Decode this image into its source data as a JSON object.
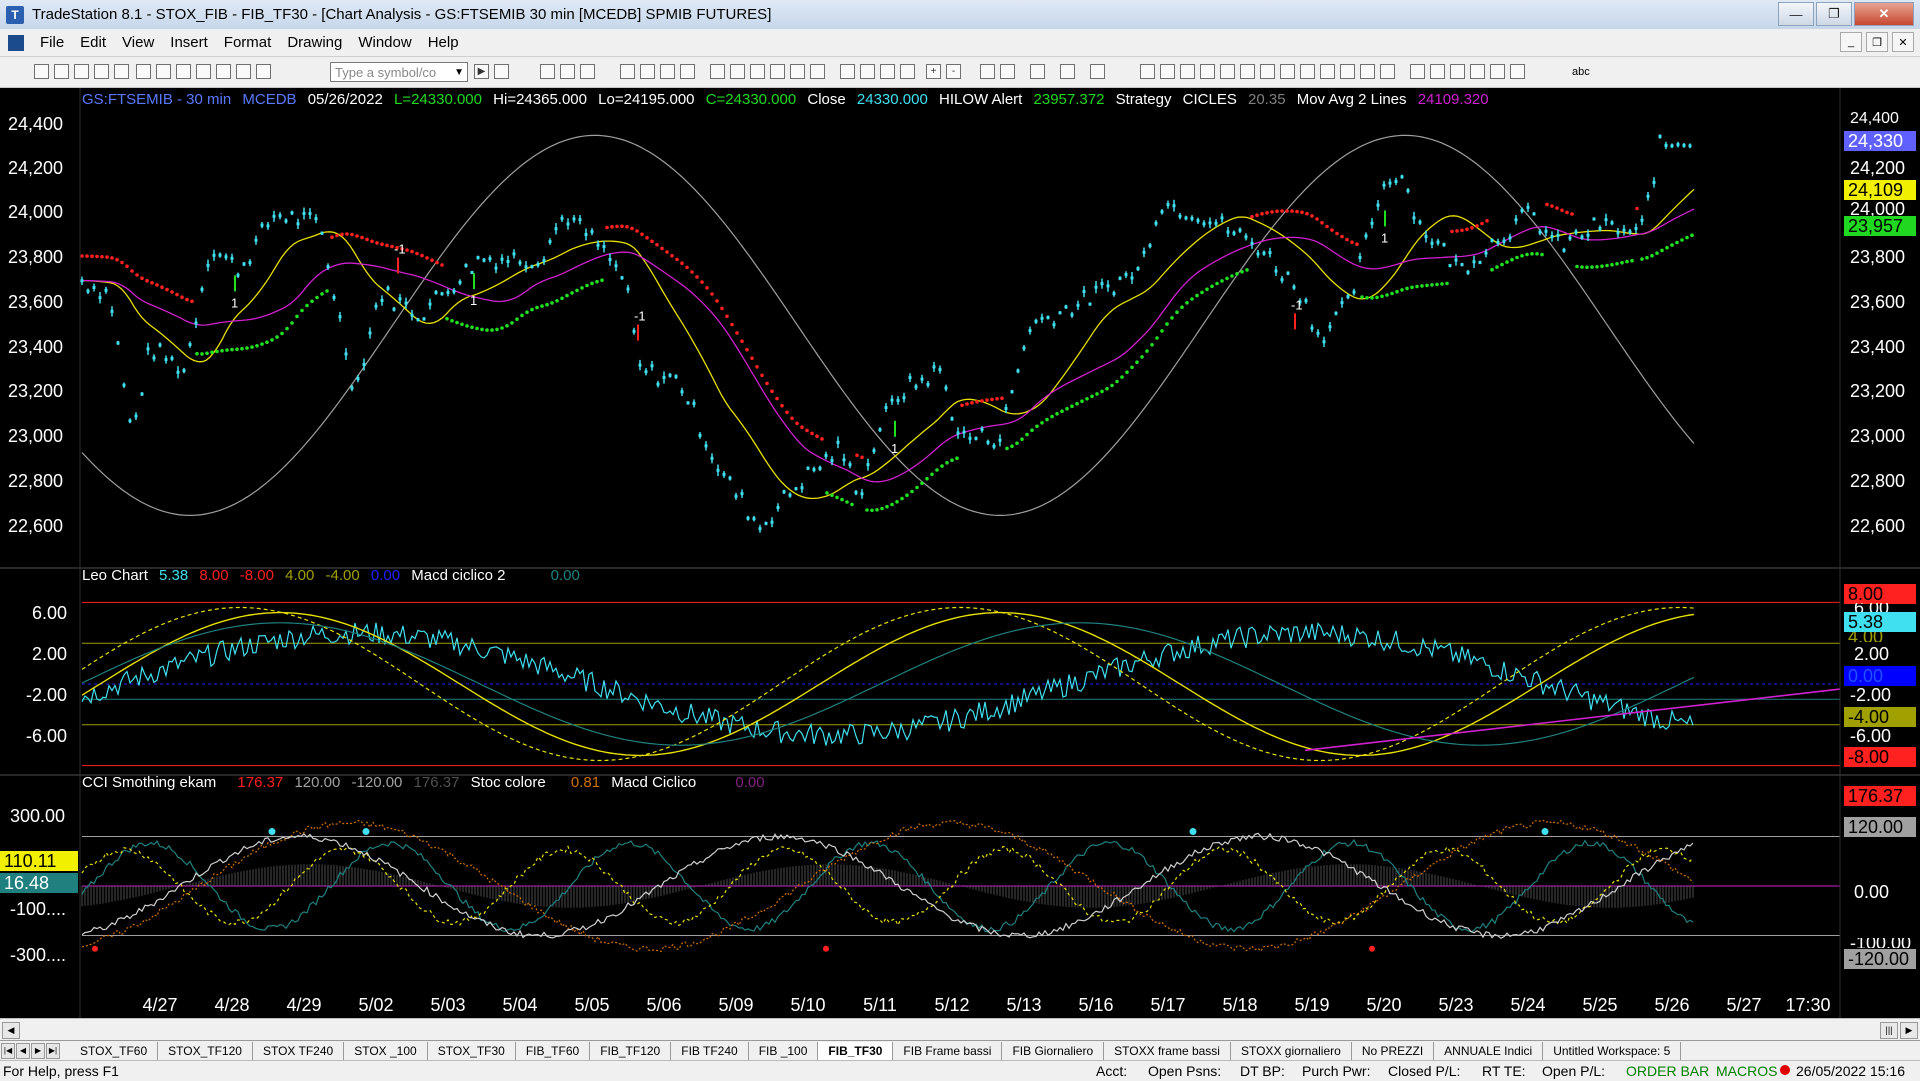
{
  "window": {
    "title": "TradeStation 8.1 - STOX_FIB - FIB_TF30 - [Chart Analysis - GS:FTSEMIB  30 min  [MCEDB] SPMIB FUTURES]",
    "icon": "tradestation-app-icon"
  },
  "menu": [
    "File",
    "Edit",
    "View",
    "Insert",
    "Format",
    "Drawing",
    "Window",
    "Help"
  ],
  "toolbar": {
    "symbol_placeholder": "Type a symbol/co",
    "text_tool": "abc"
  },
  "price_panel": {
    "header": {
      "symbol": "GS:FTSEMIB - 30 min",
      "feed": "MCEDB",
      "date": "05/26/2022",
      "low_label": "L=24330.000",
      "hi": "Hi=24365.000",
      "lo": "Lo=24195.000",
      "close_c": "C=24330.000",
      "close_label": "Close",
      "close_value": "24330.000",
      "hilow_label": "HILOW Alert",
      "hilow_value": "23957.372",
      "strategy_label": "Strategy",
      "cicles_label": "CICLES",
      "cicles_value": "20.35",
      "mavg_label": "Mov Avg 2 Lines",
      "mavg_value": "24109.320"
    },
    "y_labels": [
      "24,400",
      "24,200",
      "24,000",
      "23,800",
      "23,600",
      "23,400",
      "23,200",
      "23,000",
      "22,800",
      "22,600"
    ],
    "right_labels": {
      "top_partial": "24,400",
      "last": "24,330",
      "r200": "24,200",
      "mavg": "24,109",
      "r000": "24,000",
      "hilow": "23,957",
      "r800": "23,800",
      "r600": "23,600",
      "r400": "23,400",
      "r200b": "23,200",
      "r000b": "23,000",
      "r800b": "22,800",
      "r600b": "22,600"
    },
    "signal_labels": [
      "1",
      "-1",
      "1",
      "-1",
      "1",
      "1",
      "-1",
      "1"
    ]
  },
  "leo_panel": {
    "header": {
      "name": "Leo Chart",
      "v1": "5.38",
      "v2": "8.00",
      "v3": "-8.00",
      "v4": "4.00",
      "v5": "-4.00",
      "v6": "0.00",
      "macd_label": "Macd ciclico 2",
      "macd_value": "0.00"
    },
    "y_labels": [
      "6.00",
      "2.00",
      "-2.00",
      "-6.00"
    ],
    "right_labels": [
      "8.00",
      "6.00",
      "5.38",
      "4.00",
      "2.00",
      "0.00",
      "-2.00",
      "-4.00",
      "-6.00",
      "-8.00"
    ]
  },
  "cci_panel": {
    "header": {
      "name": "CCI Smothing ekam",
      "v1": "176.37",
      "v2": "120.00",
      "v3": "-120.00",
      "v4": "176.37",
      "stoc_label": "Stoc colore",
      "stoc_value": "0.81",
      "macd_label": "Macd Ciclico",
      "macd_value": "0.00"
    },
    "y_labels": [
      "300.00",
      "-100....",
      "-300...."
    ],
    "left_boxes": [
      "110.11",
      "16.48"
    ],
    "right_labels": [
      "176.37",
      "120.00",
      "0.00",
      "-100.00",
      "-120.00"
    ]
  },
  "x_axis": [
    "4/27",
    "4/28",
    "4/29",
    "5/02",
    "5/03",
    "5/04",
    "5/05",
    "5/06",
    "5/09",
    "5/10",
    "5/11",
    "5/12",
    "5/13",
    "5/16",
    "5/17",
    "5/18",
    "5/19",
    "5/20",
    "5/23",
    "5/24",
    "5/25",
    "5/26",
    "5/27",
    "17:30"
  ],
  "tabs": [
    "STOX_TF60",
    "STOX_TF120",
    "STOX TF240",
    "STOX _100",
    "STOX_TF30",
    "FIB_TF60",
    "FIB_TF120",
    "FIB TF240",
    "FIB _100",
    "FIB_TF30",
    "FIB Frame bassi",
    "FIB Giornaliero",
    "STOXX frame bassi",
    "STOXX giornaliero",
    "No PREZZI",
    "ANNUALE Indici",
    "Untitled Workspace: 5"
  ],
  "active_tab": "FIB_TF30",
  "status": {
    "help": "For Help, press F1",
    "acct": "Acct:",
    "open_psns": "Open Psns:",
    "dt_bp": "DT BP:",
    "purch_pwr": "Purch Pwr:",
    "closed_pl": "Closed P/L:",
    "rt_te": "RT TE:",
    "open_pl": "Open P/L:",
    "order_bar": "ORDER BAR",
    "macros": "MACROS",
    "datetime": "26/05/2022 15:16"
  },
  "colors": {
    "bars": "#40e0f0",
    "red_stop": "#ff2020",
    "green_stop": "#20e020",
    "yellow_ma": "#e8e000",
    "magenta_ma": "#d020d0",
    "cycle": "#a0a0a0"
  }
}
